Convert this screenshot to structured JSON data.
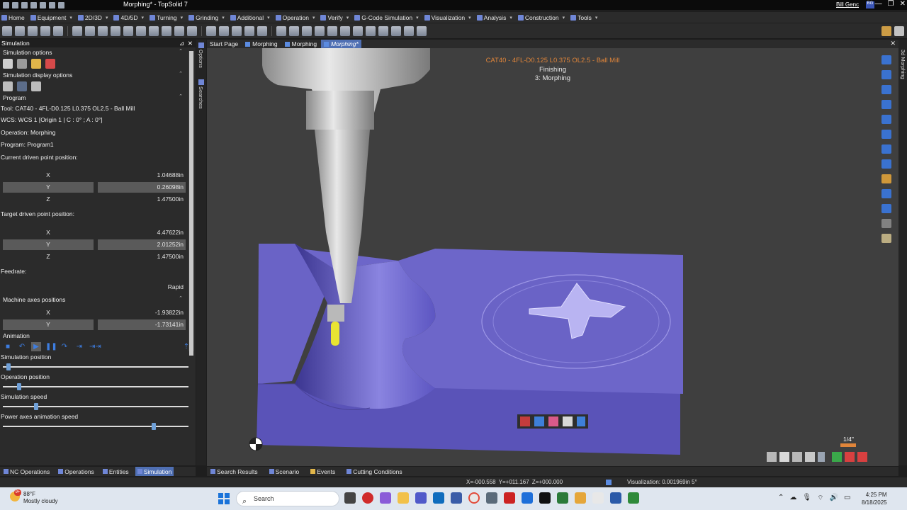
{
  "titlebar": {
    "title": "Morphing* - TopSolid 7",
    "user": "Bill Genc",
    "user_badge": "BG",
    "win_min": "—",
    "win_max": "❐",
    "win_close": "✕"
  },
  "menu": [
    {
      "label": "Home"
    },
    {
      "label": "Equipment"
    },
    {
      "label": "2D/3D"
    },
    {
      "label": "4D/5D"
    },
    {
      "label": "Turning"
    },
    {
      "label": "Grinding"
    },
    {
      "label": "Additional"
    },
    {
      "label": "Operation"
    },
    {
      "label": "Verify"
    },
    {
      "label": "G-Code Simulation"
    },
    {
      "label": "Visualization"
    },
    {
      "label": "Analysis"
    },
    {
      "label": "Construction"
    },
    {
      "label": "Tools"
    }
  ],
  "left_panel": {
    "header": "Simulation",
    "pin": "⊿",
    "close": "✕",
    "sim_options": "Simulation options",
    "sim_display": "Simulation display options",
    "program_header": "Program",
    "tool": "Tool: CAT40 - 4FL-D0.125 L0.375 OL2.5 - Ball Mill",
    "wcs": "WCS: WCS 1 [Origin 1 | C : 0° ; A : 0°]",
    "operation": "Operation: Morphing",
    "program": "Program: Program1",
    "current_pos_label": "Current driven point position:",
    "current_pos": [
      {
        "axis": "X",
        "value": "1.04688in"
      },
      {
        "axis": "Y",
        "value": "0.26098in"
      },
      {
        "axis": "Z",
        "value": "1.47500in"
      }
    ],
    "target_pos_label": "Target driven point position:",
    "target_pos": [
      {
        "axis": "X",
        "value": "4.47622in"
      },
      {
        "axis": "Y",
        "value": "2.01252in"
      },
      {
        "axis": "Z",
        "value": "1.47500in"
      }
    ],
    "feedrate_label": "Feedrate:",
    "feedrate_value": "Rapid",
    "machine_axes_label": "Machine axes positions",
    "machine_axes": [
      {
        "axis": "X",
        "value": "-1.93822in"
      },
      {
        "axis": "Y",
        "value": "-1.73141in"
      }
    ],
    "animation_label": "Animation",
    "sim_position_label": "Simulation position",
    "sim_position": 0.02,
    "op_position_label": "Operation position",
    "op_position": 0.08,
    "sim_speed_label": "Simulation speed",
    "sim_speed": 0.17,
    "power_axes_label": "Power axes animation speed",
    "power_axes": 0.82
  },
  "left_tabs": [
    {
      "label": "NC Operations"
    },
    {
      "label": "Operations"
    },
    {
      "label": "Entities"
    },
    {
      "label": "Simulation"
    }
  ],
  "side_strip": {
    "options": "Options",
    "searches": "Searches"
  },
  "doc_tabs": [
    {
      "label": "Start Page"
    },
    {
      "label": "Morphing"
    },
    {
      "label": "Morphing"
    },
    {
      "label": "Morphing*"
    }
  ],
  "viewport": {
    "tool_line": "CAT40 - 4FL-D0.125 L0.375 OL2.5 - Ball Mill",
    "op_line1": "Finishing",
    "op_line2": "3: Morphing",
    "scale_label": "1/4\"",
    "close": "✕",
    "part_color": "#6d66c9",
    "tool_tip_color": "#e9e432"
  },
  "right_strip": {
    "label": "3d Morphing"
  },
  "center_tabs": [
    {
      "label": "Search Results"
    },
    {
      "label": "Scenario"
    },
    {
      "label": "Events"
    },
    {
      "label": "Cutting Conditions"
    }
  ],
  "status": {
    "coords": "X=-000.558  Y=+011.167  Z=+000.000",
    "visualization": "Visualization: 0.001969in 5°"
  },
  "taskbar": {
    "temp": "88°F",
    "weather": "Mostly cloudy",
    "badge": "9+",
    "search_placeholder": "Search",
    "time": "4:25 PM",
    "date": "8/18/2025"
  }
}
